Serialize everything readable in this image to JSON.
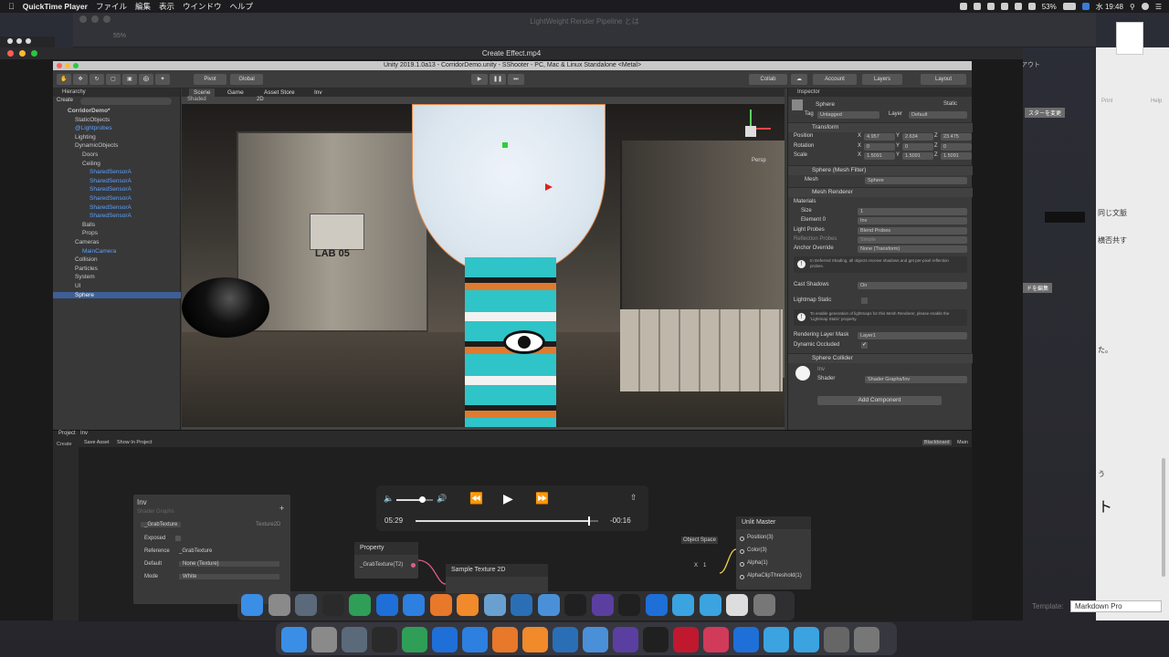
{
  "menubar": {
    "app_name": "QuickTime Player",
    "items": [
      "ファイル",
      "編集",
      "表示",
      "ウインドウ",
      "ヘルプ"
    ],
    "battery": "53%",
    "clock": "水 19:48"
  },
  "background_window": {
    "title": "LightWeight Render Pipeline とは",
    "zoom": "55%"
  },
  "quicktime": {
    "title": "Create Effect.mp4",
    "time_elapsed": "05:29",
    "time_remaining": "-00:16",
    "progress": 0.95,
    "volume": 0.7
  },
  "unity": {
    "title": "Unity 2019.1.0a13 - CorridorDemo.unity - SShooter - PC, Mac & Linux Standalone <Metal>",
    "toolbar": {
      "pivot": "Pivot",
      "global": "Global",
      "collab": "Collab",
      "account": "Account",
      "layers": "Layers",
      "layout": "Layout"
    },
    "hierarchy": {
      "header": "Hierarchy",
      "create": "Create",
      "all": "All",
      "rows": [
        {
          "label": "CorridorDemo*",
          "indent": 0,
          "style": "bold"
        },
        {
          "label": "StaticObjects",
          "indent": 1,
          "style": "normal"
        },
        {
          "label": "@Lightprobes",
          "indent": 1,
          "style": "blue"
        },
        {
          "label": "Lighting",
          "indent": 1,
          "style": "normal"
        },
        {
          "label": "DynamicObjects",
          "indent": 1,
          "style": "normal"
        },
        {
          "label": "Doors",
          "indent": 2,
          "style": "normal"
        },
        {
          "label": "Ceiling",
          "indent": 2,
          "style": "normal"
        },
        {
          "label": "SharedSensorA",
          "indent": 3,
          "style": "blue"
        },
        {
          "label": "SharedSensorA",
          "indent": 3,
          "style": "blue"
        },
        {
          "label": "SharedSensorA",
          "indent": 3,
          "style": "blue"
        },
        {
          "label": "SharedSensorA",
          "indent": 3,
          "style": "blue"
        },
        {
          "label": "SharedSensorA",
          "indent": 3,
          "style": "blue"
        },
        {
          "label": "SharedSensorA",
          "indent": 3,
          "style": "blue"
        },
        {
          "label": "Balls",
          "indent": 2,
          "style": "normal"
        },
        {
          "label": "Props",
          "indent": 2,
          "style": "normal"
        },
        {
          "label": "Cameras",
          "indent": 1,
          "style": "normal"
        },
        {
          "label": "MainCamera",
          "indent": 2,
          "style": "blue"
        },
        {
          "label": "Collision",
          "indent": 1,
          "style": "normal"
        },
        {
          "label": "Particles",
          "indent": 1,
          "style": "normal"
        },
        {
          "label": "System",
          "indent": 1,
          "style": "normal"
        },
        {
          "label": "UI",
          "indent": 1,
          "style": "normal"
        },
        {
          "label": "Sphere",
          "indent": 1,
          "style": "selected"
        }
      ]
    },
    "scene_tabs": [
      "Scene",
      "Game",
      "Asset Store",
      "Inv"
    ],
    "scene_shading": "Shaded",
    "scene_mode": "2D",
    "scene_label_lab": "LAB 05",
    "persp": "Persp",
    "inspector": {
      "header": "Inspector",
      "object_name": "Sphere",
      "static_label": "Static",
      "tag_label": "Tag",
      "tag_value": "Untagged",
      "layer_label": "Layer",
      "layer_value": "Default",
      "transform": {
        "title": "Transform",
        "position": {
          "label": "Position",
          "x": "4.957",
          "y": "2.634",
          "z": "23.475"
        },
        "rotation": {
          "label": "Rotation",
          "x": "0",
          "y": "0",
          "z": "0"
        },
        "scale": {
          "label": "Scale",
          "x": "1.5091",
          "y": "1.5091",
          "z": "1.5091"
        }
      },
      "mesh_filter": {
        "title": "Sphere (Mesh Filter)",
        "mesh_label": "Mesh",
        "mesh_value": "Sphere"
      },
      "mesh_renderer": {
        "title": "Mesh Renderer",
        "materials_label": "Materials",
        "size_label": "Size",
        "size_value": "1",
        "element_label": "Element 0",
        "element_value": "Inv",
        "light_probes_label": "Light Probes",
        "light_probes_value": "Blend Probes",
        "reflection_label": "Reflection Probes",
        "reflection_value": "Simple",
        "anchor_label": "Anchor Override",
        "anchor_value": "None (Transform)",
        "info1": "In Deferred Shading, all objects receive shadows and get per-pixel reflection probes.",
        "cast_label": "Cast Shadows",
        "cast_value": "On",
        "lightmap_label": "Lightmap Static",
        "info2": "To enable generation of lightmaps for this Mesh Renderer, please enable the 'Lightmap Static' property.",
        "rendering_layer_label": "Rendering Layer Mask",
        "rendering_layer_value": "Layer1",
        "dynamic_label": "Dynamic Occluded"
      },
      "collider": {
        "title": "Sphere Collider"
      },
      "material": {
        "name": "Inv",
        "shader_label": "Shader",
        "shader_value": "Shader Graphs/Inv"
      },
      "add_component": "Add Component"
    },
    "project": {
      "tab": "Project",
      "create": "Create",
      "graph_tab": "Inv",
      "save_asset": "Save Asset",
      "show_in_project": "Show In Project",
      "blackboard": "Blackboard",
      "main_preview": "Main"
    },
    "blackboard_panel": {
      "title": "Inv",
      "subtitle": "Shader Graphs",
      "property_name": "_GrabTexture",
      "property_type": "Texture2D",
      "exposed_label": "Exposed",
      "reference_label": "Reference",
      "reference_value": "_GrabTexture",
      "default_label": "Default",
      "default_value": "None (Texture)",
      "mode_label": "Mode",
      "mode_value": "White"
    },
    "nodes": {
      "property": {
        "title": "Property",
        "output": "_GrabTexture(T2)"
      },
      "sample": {
        "title": "Sample Texture 2D"
      },
      "unlit": {
        "title": "Unlit Master",
        "space": "Object Space",
        "ports": [
          "Position(3)",
          "Color(3)",
          "Alpha(1)",
          "AlphaClipThreshold(1)"
        ],
        "x_label": "X",
        "x_value": "1"
      }
    }
  },
  "right_window": {
    "texts": [
      "アウト",
      "スターを変更",
      "Print",
      "Help",
      "同じ文脈",
      "横否共す",
      "ドを編集",
      "た。",
      "う",
      "ト",
      "Template:",
      "Markdown Pro"
    ]
  },
  "colors": {
    "accent_blue": "#3e5f96",
    "link_blue": "#5ca0ff",
    "unity_bg": "#3a3a3a",
    "teal": "#2fc4c8",
    "orange": "#e07a2e"
  }
}
